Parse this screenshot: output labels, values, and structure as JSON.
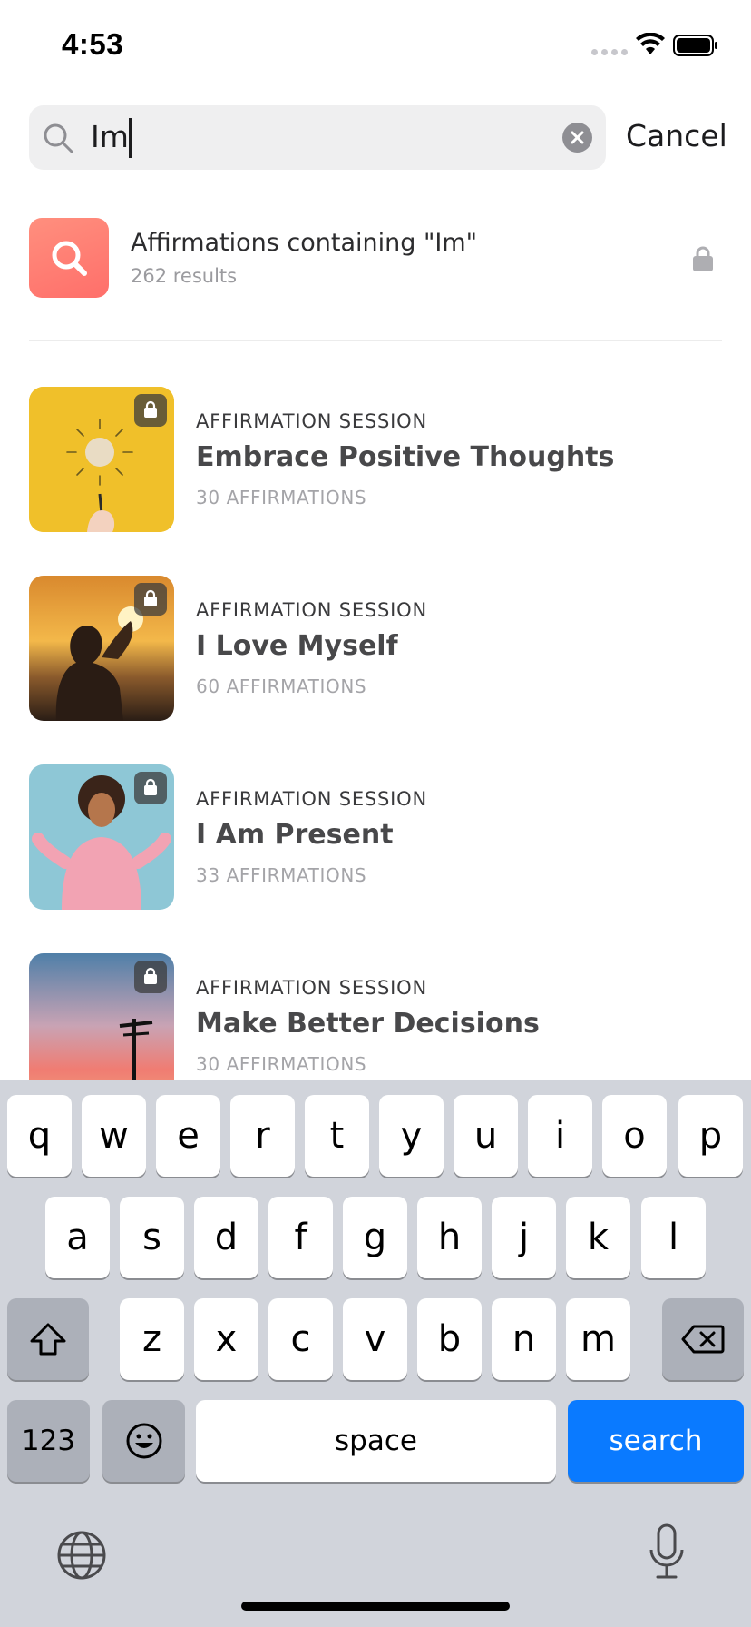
{
  "status_bar": {
    "time": "4:53"
  },
  "search": {
    "query": "Im",
    "cancel_label": "Cancel"
  },
  "summary": {
    "title": "Affirmations containing \"Im\"",
    "count": "262 results"
  },
  "results": [
    {
      "kicker": "AFFIRMATION SESSION",
      "title": "Embrace Positive Thoughts",
      "count": "30 AFFIRMATIONS"
    },
    {
      "kicker": "AFFIRMATION SESSION",
      "title": "I Love Myself",
      "count": "60 AFFIRMATIONS"
    },
    {
      "kicker": "AFFIRMATION SESSION",
      "title": "I Am Present",
      "count": "33 AFFIRMATIONS"
    },
    {
      "kicker": "AFFIRMATION SESSION",
      "title": "Make Better Decisions",
      "count": "30 AFFIRMATIONS"
    }
  ],
  "keyboard": {
    "row1": [
      "q",
      "w",
      "e",
      "r",
      "t",
      "y",
      "u",
      "i",
      "o",
      "p"
    ],
    "row2": [
      "a",
      "s",
      "d",
      "f",
      "g",
      "h",
      "j",
      "k",
      "l"
    ],
    "row3": [
      "z",
      "x",
      "c",
      "v",
      "b",
      "n",
      "m"
    ],
    "numbers_label": "123",
    "space_label": "space",
    "search_label": "search"
  },
  "colors": {
    "accent": "#0a7aff",
    "summary_icon": "#ff7b72"
  }
}
